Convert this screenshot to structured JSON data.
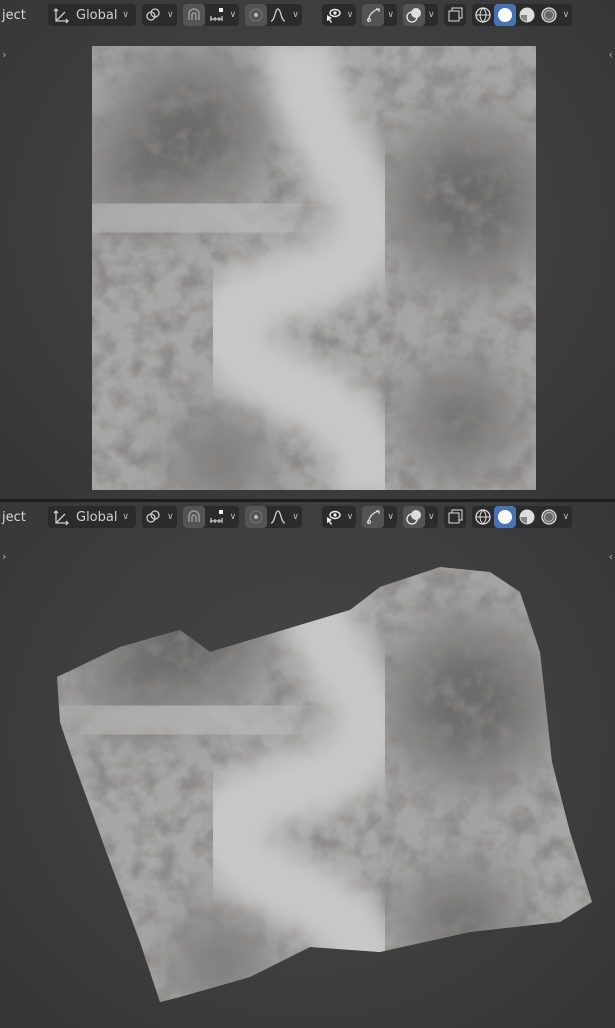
{
  "viewports": [
    {
      "mode_label": "ject",
      "orientation": "Global",
      "view": "top"
    },
    {
      "mode_label": "ject",
      "orientation": "Global",
      "view": "perspective"
    }
  ],
  "header": {
    "icons": [
      "transform-orientation-icon",
      "link-icon",
      "snap-icon",
      "snap-increment-icon",
      "proportional-edit-icon",
      "falloff-icon",
      "visibility-icon",
      "gizmo-icon",
      "overlay-icon",
      "xray-icon",
      "wireframe-shading-icon",
      "solid-shading-icon",
      "material-shading-icon",
      "rendered-shading-icon"
    ],
    "active_shading": "solid"
  },
  "colors": {
    "accent": "#4772b3",
    "background": "#3d3d3d",
    "terrain": "#a9a9a9"
  }
}
